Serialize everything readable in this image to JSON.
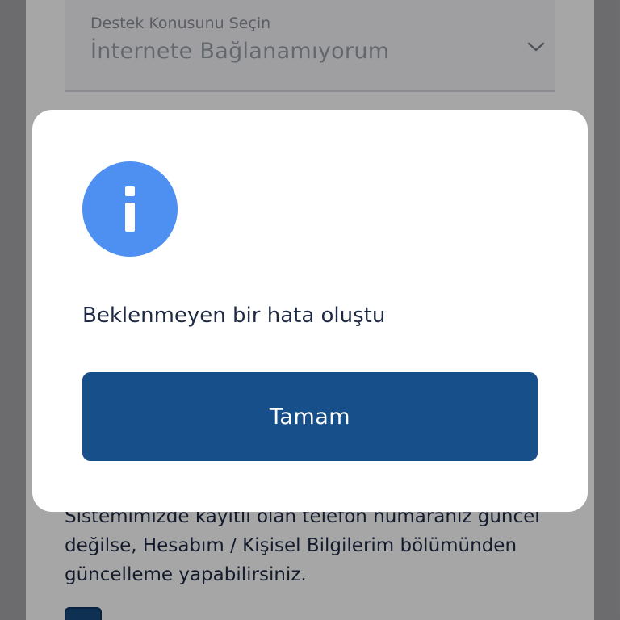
{
  "background": {
    "support_topic": {
      "label": "Destek Konusunu Seçin",
      "value": "İnternete Bağlanamıyorum"
    },
    "info_text": "Sistemimizde kayıtlı olan telefon numaranız güncel değilse, Hesabım / Kişisel Bilgilerim bölümünden güncelleme yapabilirsiniz."
  },
  "dialog": {
    "icon": "info-icon",
    "message": "Beklenmeyen bir hata oluştu",
    "ok_label": "Tamam"
  },
  "colors": {
    "accent": "#174f8a",
    "info_icon": "#4e8ff2",
    "text": "#1f2a44"
  }
}
